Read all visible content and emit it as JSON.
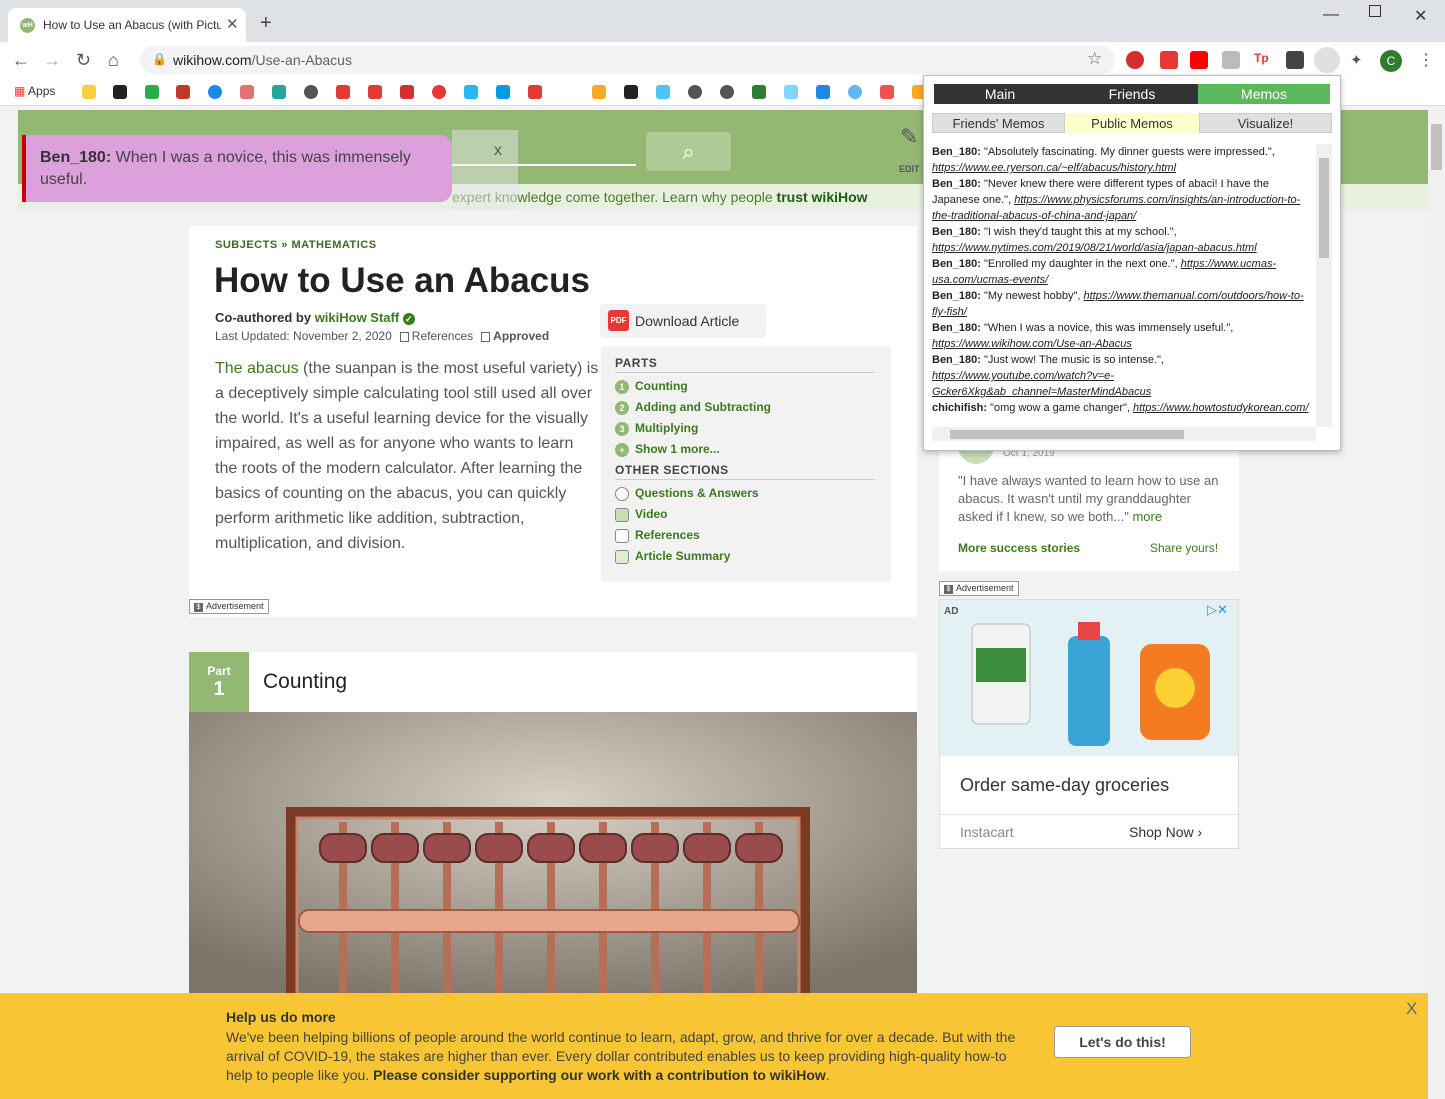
{
  "browser": {
    "tab_title": "How to Use an Abacus (with Pictu",
    "url_host": "wikihow.com",
    "url_path": "/Use-an-Abacus",
    "bookmarks_apps": "Apps"
  },
  "site": {
    "edit_label": "EDIT",
    "trust_text": "expert knowledge come together. Learn why people ",
    "trust_link": "trust wikiHow"
  },
  "toast": {
    "user": "Ben_180:",
    "message": "When I was a novice, this was immensely useful.",
    "close": "x"
  },
  "article": {
    "crumb_subjects": "SUBJECTS",
    "crumb_sep": "»",
    "crumb_math": "MATHEMATICS",
    "title": "How to Use an Abacus",
    "coauthor_prefix": "Co-authored by",
    "coauthor_name": "wikiHow Staff",
    "updated": "Last Updated: November 2, 2020",
    "references": "References",
    "approved": "Approved",
    "intro_link": "The abacus",
    "intro_rest": " (the suanpan is the most useful variety) is a deceptively simple calculating tool still used all over the world. It's a useful learning device for the visually impaired, as well as for anyone who wants to learn the roots of the modern calculator. After learning the basics of counting on the abacus, you can quickly perform arithmetic like addition, subtraction, multiplication, and division.",
    "download": "Download Article",
    "pdf_icon": "PDF",
    "advertisement": "Advertisement"
  },
  "toc": {
    "parts_heading": "PARTS",
    "parts": [
      {
        "num": "1",
        "label": "Counting"
      },
      {
        "num": "2",
        "label": "Adding and Subtracting"
      },
      {
        "num": "3",
        "label": "Multiplying"
      },
      {
        "num": "+",
        "label": "Show 1 more..."
      }
    ],
    "other_heading": "OTHER SECTIONS",
    "other": [
      {
        "label": "Questions & Answers",
        "icon": "question-icon"
      },
      {
        "label": "Video",
        "icon": "video-icon"
      },
      {
        "label": "References",
        "icon": "document-icon"
      },
      {
        "label": "Article Summary",
        "icon": "summary-icon"
      }
    ]
  },
  "part": {
    "prefix": "Part",
    "number": "1",
    "title": "Counting"
  },
  "success_story": {
    "date": "Oct 1, 2019",
    "quote": "\"I have always wanted to learn how to use an abacus. It wasn't until my granddaughter asked if I knew, so we both...\"",
    "more": "more",
    "more_stories": "More success stories",
    "share": "Share yours!"
  },
  "ad": {
    "label": "Advertisement",
    "ad_tag": "AD",
    "headline": "Order same-day groceries",
    "source": "Instacart",
    "cta": "Shop Now"
  },
  "donation": {
    "heading": "Help us do more",
    "body": "We've been helping billions of people around the world continue to learn, adapt, grow, and thrive for over a decade. But with the arrival of COVID-19, the stakes are higher than ever. Every dollar contributed enables us to keep providing high-quality how-to help to people like you. ",
    "body_bold": "Please consider supporting our work with a contribution to wikiHow",
    "button": "Let's do this!",
    "close": "X"
  },
  "popup": {
    "tabs": [
      "Main",
      "Friends",
      "Memos"
    ],
    "subtabs": [
      "Friends' Memos",
      "Public Memos",
      "Visualize!"
    ],
    "memos": [
      {
        "user": "Ben_180:",
        "text": "\"Absolutely fascinating. My dinner guests were impressed.\",",
        "link": "https://www.ee.ryerson.ca/~elf/abacus/history.html"
      },
      {
        "user": "Ben_180:",
        "text": "\"Never knew there were different types of abaci! I have the Japanese one.\",",
        "link": "https://www.physicsforums.com/insights/an-introduction-to-the-traditional-abacus-of-china-and-japan/"
      },
      {
        "user": "Ben_180:",
        "text": "\"I wish they'd taught this at my school.\",",
        "link": "https://www.nytimes.com/2019/08/21/world/asia/japan-abacus.html"
      },
      {
        "user": "Ben_180:",
        "text": "\"Enrolled my daughter in the next one.\",",
        "link": "https://www.ucmas-usa.com/ucmas-events/"
      },
      {
        "user": "Ben_180:",
        "text": "\"My newest hobby\",",
        "link": "https://www.themanual.com/outdoors/how-to-fly-fish/"
      },
      {
        "user": "Ben_180:",
        "text": "\"When I was a novice, this was immensely useful.\",",
        "link": "https://www.wikihow.com/Use-an-Abacus"
      },
      {
        "user": "Ben_180:",
        "text": "\"Just wow! The music is so intense.\",",
        "link": "https://www.youtube.com/watch?v=e-Gcker6Xkg&ab_channel=MasterMindAbacus"
      },
      {
        "user": "chichifish:",
        "text": "\"omg wow a game changer\",",
        "link": "https://www.howtostudykorean.com/"
      }
    ]
  },
  "colors": {
    "wikihow_green": "#93b874",
    "link_green": "#3b7a1e",
    "toast_bg": "#dca0dc",
    "donate_bg": "#f8c534",
    "popup_active_tab": "#5cb85c",
    "popup_active_subtab": "#ffffcc"
  }
}
